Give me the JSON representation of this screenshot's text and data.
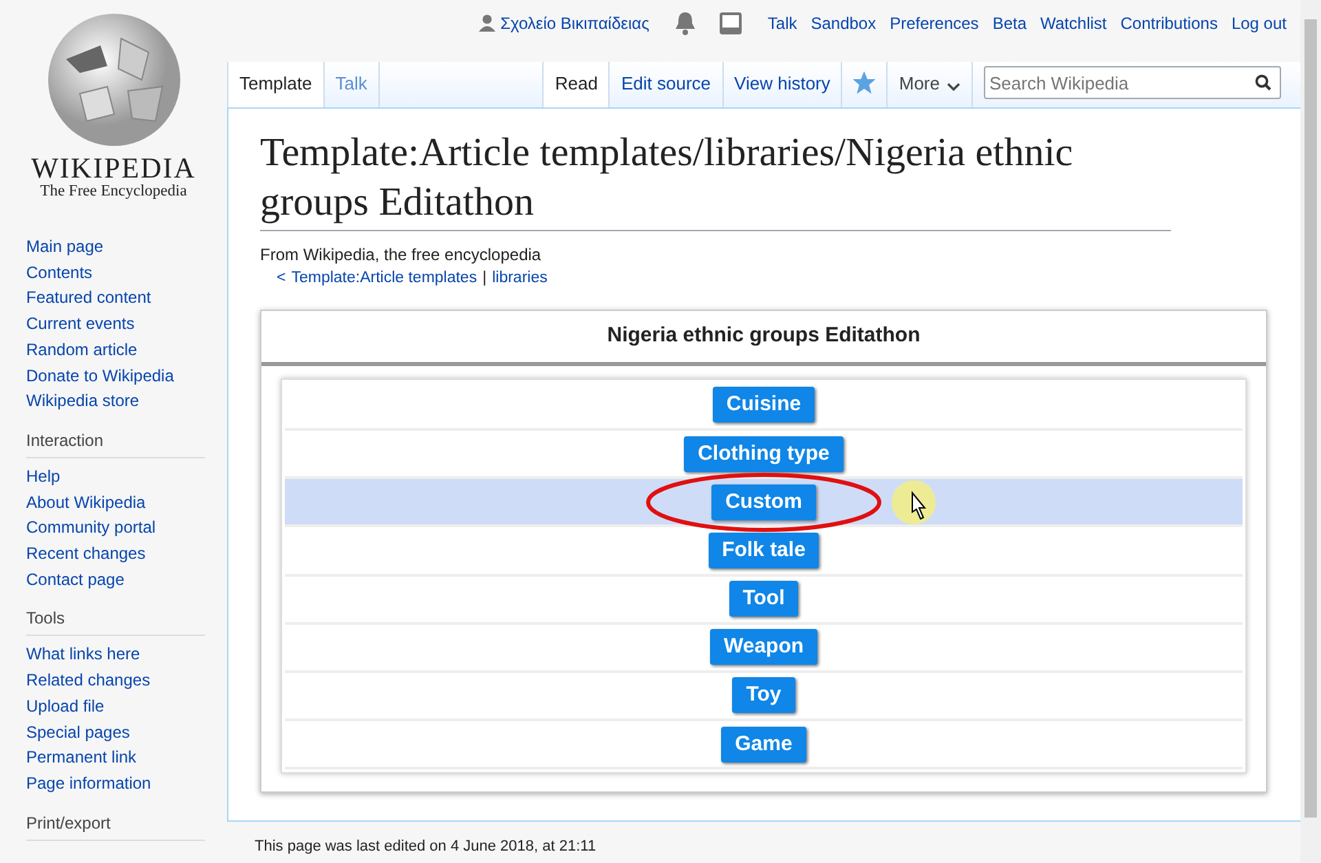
{
  "personal_tools": {
    "user": "Σχολείο Βικιπαίδειας",
    "links": [
      "Talk",
      "Sandbox",
      "Preferences",
      "Beta",
      "Watchlist",
      "Contributions",
      "Log out"
    ]
  },
  "logo": {
    "wordmark": "WIKIPEDIA",
    "tagline": "The Free Encyclopedia"
  },
  "sidebar": {
    "navigation": [
      "Main page",
      "Contents",
      "Featured content",
      "Current events",
      "Random article",
      "Donate to Wikipedia",
      "Wikipedia store"
    ],
    "sections": [
      {
        "heading": "Interaction",
        "items": [
          "Help",
          "About Wikipedia",
          "Community portal",
          "Recent changes",
          "Contact page"
        ]
      },
      {
        "heading": "Tools",
        "items": [
          "What links here",
          "Related changes",
          "Upload file",
          "Special pages",
          "Permanent link",
          "Page information"
        ]
      },
      {
        "heading": "Print/export"
      }
    ]
  },
  "namespace_tabs": [
    {
      "label": "Template",
      "selected": true
    },
    {
      "label": "Talk",
      "selected": false
    }
  ],
  "view_tabs": [
    {
      "label": "Read",
      "selected": true
    },
    {
      "label": "Edit source",
      "selected": false
    },
    {
      "label": "View history",
      "selected": false
    }
  ],
  "watch": {
    "on": true
  },
  "more_menu": {
    "label": "More"
  },
  "search": {
    "placeholder": "Search Wikipedia"
  },
  "heading": "Template:Article templates/libraries/Nigeria ethnic groups Editathon",
  "site_sub": "From Wikipedia, the free encyclopedia",
  "breadcrumb": {
    "prefix": "<",
    "links": [
      "Template:Article templates",
      "libraries"
    ],
    "separator": "|"
  },
  "navbox": {
    "title": "Nigeria ethnic groups Editathon",
    "rows": [
      {
        "label": "Cuisine",
        "selected": false
      },
      {
        "label": "Clothing type",
        "selected": false
      },
      {
        "label": "Custom",
        "selected": true,
        "circled": true
      },
      {
        "label": "Folk tale",
        "selected": false
      },
      {
        "label": "Tool",
        "selected": false
      },
      {
        "label": "Weapon",
        "selected": false
      },
      {
        "label": "Toy",
        "selected": false
      },
      {
        "label": "Game",
        "selected": false
      }
    ]
  },
  "footer": "This page was last edited on 4 June 2018, at 21:11"
}
